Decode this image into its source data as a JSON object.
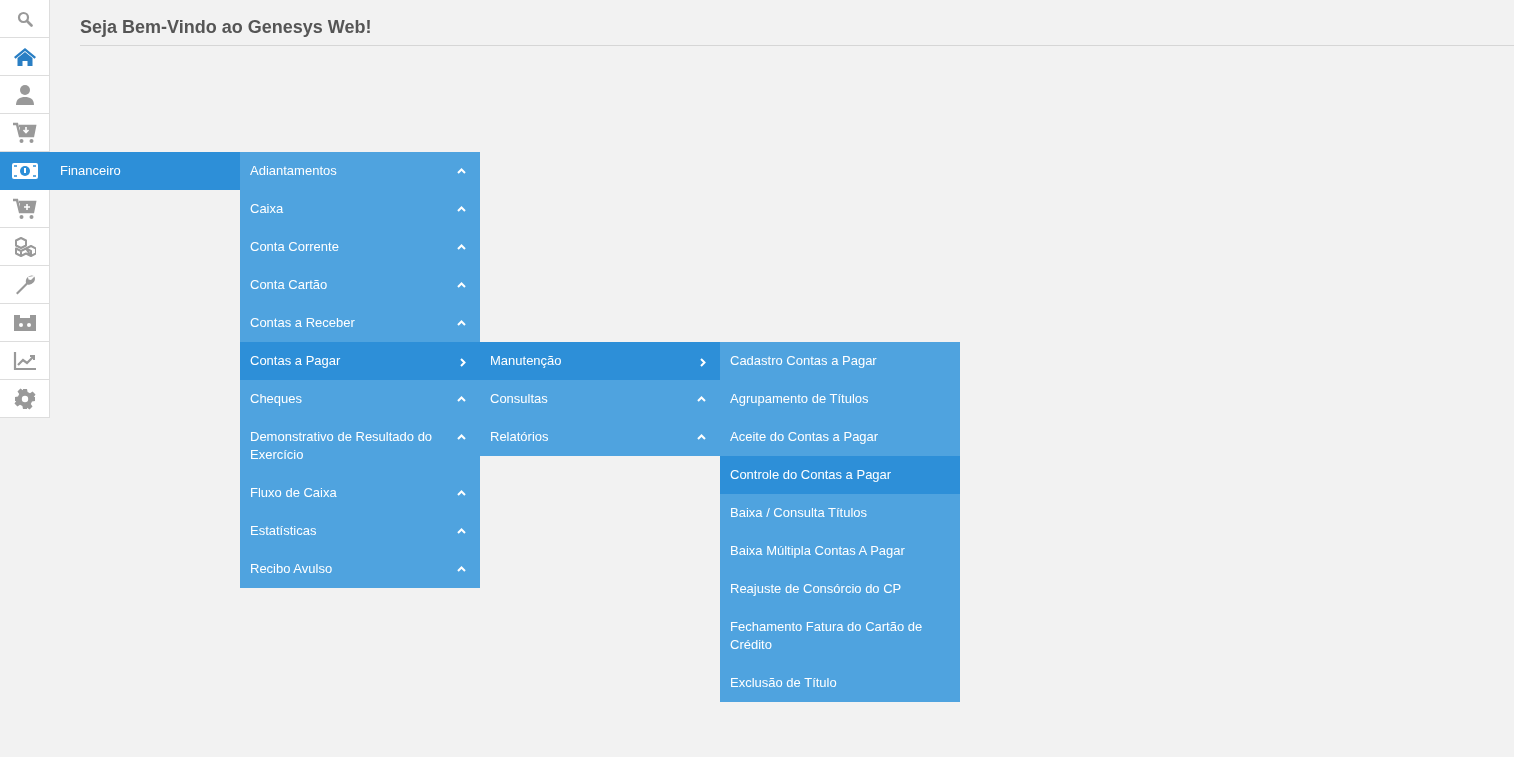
{
  "sidebar": {
    "items": [
      {
        "selected": false,
        "current": false
      },
      {
        "selected": false,
        "current": true
      },
      {
        "selected": false,
        "current": false
      },
      {
        "selected": false,
        "current": false
      },
      {
        "selected": true,
        "current": false,
        "label": "Financeiro",
        "menu": [
          {
            "label": "Adiantamentos",
            "selected": false,
            "expanded": false
          },
          {
            "label": "Caixa",
            "selected": false,
            "expanded": false
          },
          {
            "label": "Conta Corrente",
            "selected": false,
            "expanded": false
          },
          {
            "label": "Conta Cartão",
            "selected": false,
            "expanded": false
          },
          {
            "label": "Contas a Receber",
            "selected": false,
            "expanded": false
          },
          {
            "label": "Contas a Pagar",
            "selected": true,
            "expanded": true,
            "children": [
              {
                "label": "Manutenção",
                "selected": true,
                "expanded": true,
                "children": [
                  {
                    "label": "Cadastro Contas a Pagar",
                    "selected": false
                  },
                  {
                    "label": "Agrupamento de Títulos",
                    "selected": false
                  },
                  {
                    "label": "Aceite do Contas a Pagar",
                    "selected": false
                  },
                  {
                    "label": "Controle do Contas a Pagar",
                    "selected": true
                  },
                  {
                    "label": "Baixa / Consulta Títulos",
                    "selected": false
                  },
                  {
                    "label": "Baixa Múltipla Contas A Pagar",
                    "selected": false
                  },
                  {
                    "label": "Reajuste de Consórcio do CP",
                    "selected": false
                  },
                  {
                    "label": "Fechamento Fatura do Cartão de Crédito",
                    "selected": false
                  },
                  {
                    "label": "Exclusão de Título",
                    "selected": false
                  }
                ]
              },
              {
                "label": "Consultas",
                "selected": false,
                "expanded": false
              },
              {
                "label": "Relatórios",
                "selected": false,
                "expanded": false
              }
            ]
          },
          {
            "label": "Cheques",
            "selected": false,
            "expanded": false
          },
          {
            "label": "Demonstrativo de Resultado do Exercício",
            "selected": false,
            "expanded": false
          },
          {
            "label": "Fluxo de Caixa",
            "selected": false,
            "expanded": false
          },
          {
            "label": "Estatísticas",
            "selected": false,
            "expanded": false
          },
          {
            "label": "Recibo Avulso",
            "selected": false,
            "expanded": false
          }
        ]
      },
      {
        "selected": false,
        "current": false
      },
      {
        "selected": false,
        "current": false
      },
      {
        "selected": false,
        "current": false
      },
      {
        "selected": false,
        "current": false
      },
      {
        "selected": false,
        "current": false
      },
      {
        "selected": false,
        "current": false
      }
    ]
  },
  "page": {
    "title": "Seja Bem-Vindo ao Genesys Web!"
  }
}
